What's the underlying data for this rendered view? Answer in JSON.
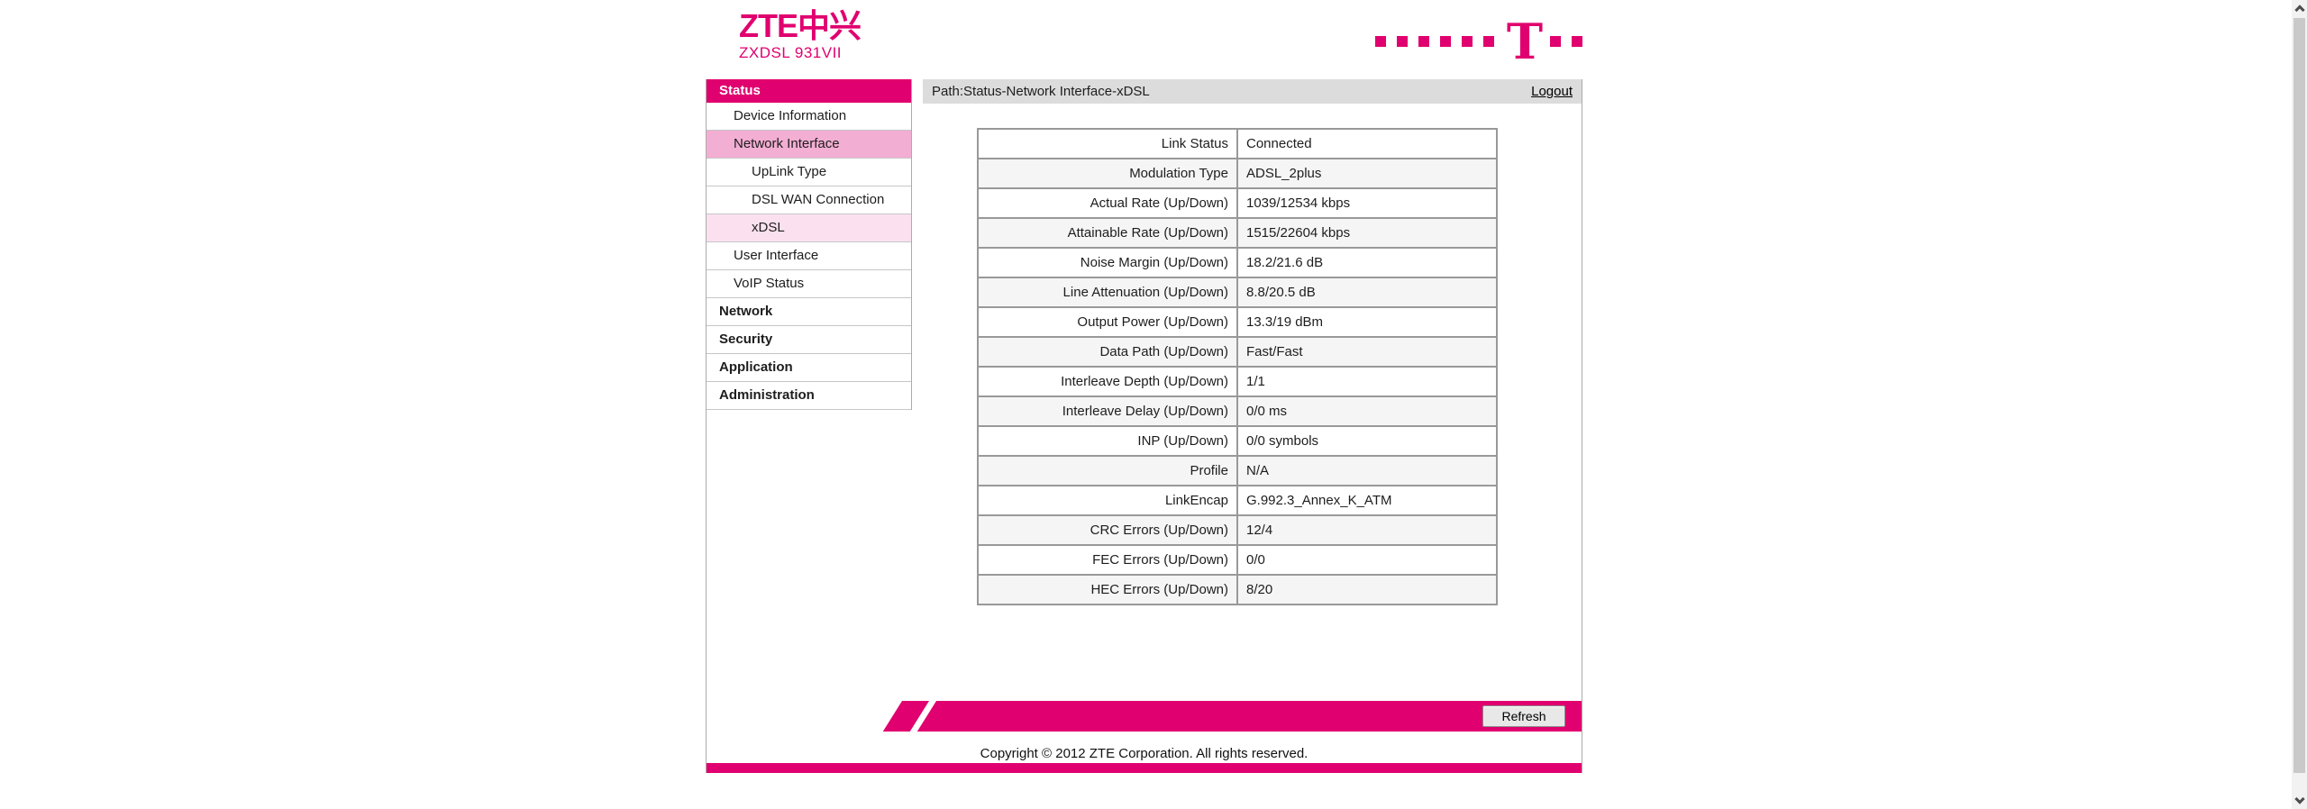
{
  "brand": {
    "logo_text": "ZTE中兴",
    "model": "ZXDSL 931VII",
    "t_glyph": "T"
  },
  "colors": {
    "magenta": "#E0006F",
    "sidebar_selected_pink": "#F3AED3",
    "sidebar_active_pink": "#FBE1EF",
    "pathbar_background": "#DCDCDC",
    "table_stripe": "#F5F5F5",
    "table_border": "#999999"
  },
  "header": {
    "path": "Path:Status-Network Interface-xDSL",
    "logout": "Logout"
  },
  "sidebar": {
    "items": [
      {
        "label": "Status",
        "type": "header",
        "level": 0
      },
      {
        "label": "Device Information",
        "type": "item",
        "level": 1
      },
      {
        "label": "Network Interface",
        "type": "item",
        "level": 1,
        "selected": true
      },
      {
        "label": "UpLink Type",
        "type": "item",
        "level": 2
      },
      {
        "label": "DSL WAN Connection",
        "type": "item",
        "level": 2
      },
      {
        "label": "xDSL",
        "type": "item",
        "level": 2,
        "active": true
      },
      {
        "label": "User Interface",
        "type": "item",
        "level": 1
      },
      {
        "label": "VoIP Status",
        "type": "item",
        "level": 1
      },
      {
        "label": "Network",
        "type": "section",
        "level": 0
      },
      {
        "label": "Security",
        "type": "section",
        "level": 0
      },
      {
        "label": "Application",
        "type": "section",
        "level": 0
      },
      {
        "label": "Administration",
        "type": "section",
        "level": 0
      }
    ]
  },
  "table": {
    "rows": [
      [
        "Link Status",
        "Connected"
      ],
      [
        "Modulation Type",
        "ADSL_2plus"
      ],
      [
        "Actual Rate (Up/Down)",
        "1039/12534 kbps"
      ],
      [
        "Attainable Rate (Up/Down)",
        "1515/22604 kbps"
      ],
      [
        "Noise Margin (Up/Down)",
        "18.2/21.6 dB"
      ],
      [
        "Line Attenuation (Up/Down)",
        "8.8/20.5 dB"
      ],
      [
        "Output Power (Up/Down)",
        "13.3/19 dBm"
      ],
      [
        "Data Path (Up/Down)",
        "Fast/Fast"
      ],
      [
        "Interleave Depth (Up/Down)",
        "1/1"
      ],
      [
        "Interleave Delay (Up/Down)",
        "0/0 ms"
      ],
      [
        "INP (Up/Down)",
        "0/0 symbols"
      ],
      [
        "Profile",
        "N/A"
      ],
      [
        "LinkEncap",
        "G.992.3_Annex_K_ATM"
      ],
      [
        "CRC Errors (Up/Down)",
        "12/4"
      ],
      [
        "FEC Errors (Up/Down)",
        "0/0"
      ],
      [
        "HEC Errors (Up/Down)",
        "8/20"
      ]
    ]
  },
  "footer": {
    "refresh_label": "Refresh",
    "copyright": "Copyright © 2012 ZTE Corporation. All rights reserved."
  },
  "icons": {
    "scrollbar_up": "chevron-up",
    "scrollbar_down": "chevron-down"
  }
}
